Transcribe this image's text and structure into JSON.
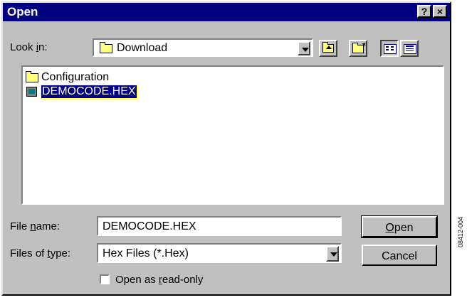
{
  "window": {
    "title": "Open",
    "help_label": "?",
    "close_label": "×"
  },
  "lookin": {
    "label_pre": "Look ",
    "label_accel": "i",
    "label_post": "n:",
    "value": "Download"
  },
  "toolbar": {
    "icons": [
      "up-one-level-icon",
      "create-new-folder-icon",
      "list-view-icon",
      "details-view-icon"
    ]
  },
  "files": [
    {
      "name": "Configuration",
      "icon": "folder-icon",
      "selected": false
    },
    {
      "name": "DEMOCODE.HEX",
      "icon": "hex-file-icon",
      "selected": true
    }
  ],
  "filename": {
    "label_pre": "File ",
    "label_accel": "n",
    "label_post": "ame:",
    "value": "DEMOCODE.HEX"
  },
  "filetype": {
    "label_pre": "Files of ",
    "label_accel": "t",
    "label_post": "ype:",
    "value": "Hex Files (*.Hex)"
  },
  "buttons": {
    "open_accel": "O",
    "open_rest": "pen",
    "cancel": "Cancel"
  },
  "readonly": {
    "label_pre": "Open as ",
    "label_accel": "r",
    "label_post": "ead-only",
    "checked": false
  },
  "figure_id": "08412-004",
  "colors": {
    "face": "#c0c0c0",
    "titlebar": "#000080",
    "selection": "#000080"
  }
}
